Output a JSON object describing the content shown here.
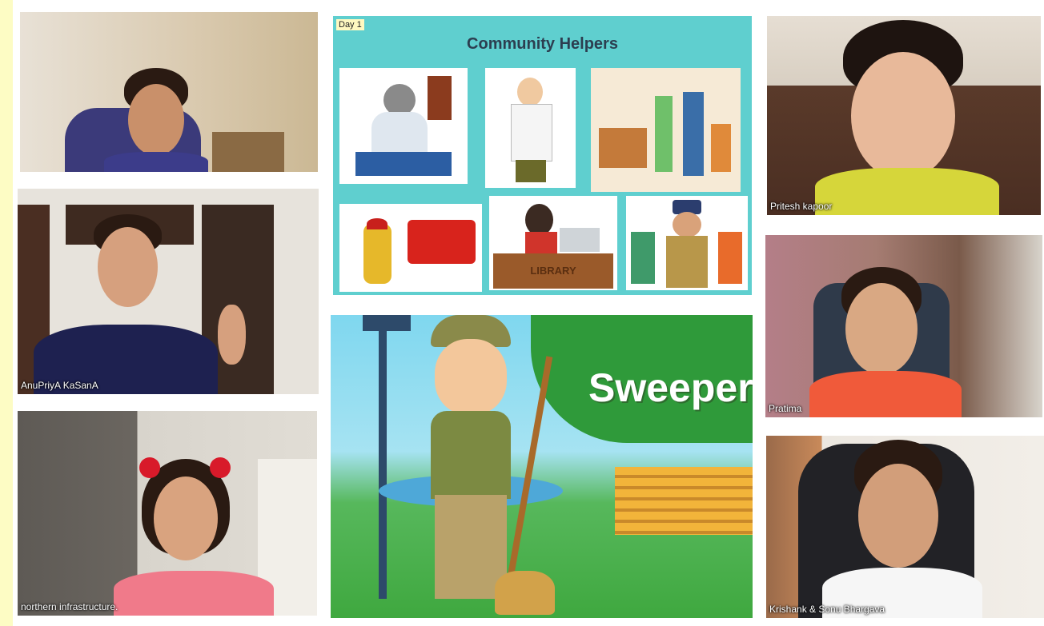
{
  "participants": [
    {
      "name": ""
    },
    {
      "name": "AnuPriyA KaSanA"
    },
    {
      "name": "northern infrastructure."
    },
    {
      "name": "Pritesh kapoor"
    },
    {
      "name": "Pratima"
    },
    {
      "name": "Krishank & Sonu Bhargava"
    }
  ],
  "slides": {
    "day_label": "Day 1",
    "title": "Community Helpers",
    "library_sign": "LIBRARY",
    "sweeper_title": "Sweeper"
  },
  "colors": {
    "slide_bg": "#5fcfcf",
    "left_strip": "#fdfcc4",
    "title_color": "#2c3e50"
  }
}
